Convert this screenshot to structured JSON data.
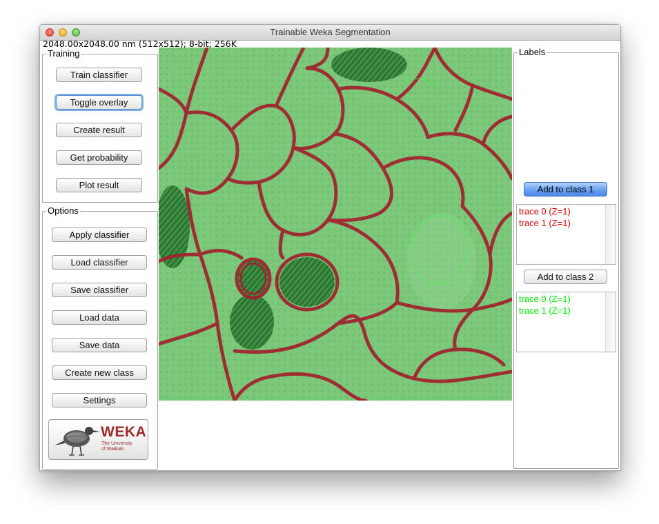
{
  "window": {
    "title": "Trainable Weka Segmentation",
    "image_info": "2048.00x2048.00 nm (512x512); 8-bit; 256K"
  },
  "training": {
    "title": "Training",
    "buttons": [
      "Train classifier",
      "Toggle overlay",
      "Create result",
      "Get probability",
      "Plot result"
    ]
  },
  "options": {
    "title": "Options",
    "buttons": [
      "Apply classifier",
      "Load classifier",
      "Save classifier",
      "Load data",
      "Save data",
      "Create new class",
      "Settings"
    ]
  },
  "weka_logo": {
    "name": "WEKA",
    "subtitle_line1": "The University",
    "subtitle_line2": "of Waikato",
    "icon": "weka-bird-icon"
  },
  "labels": {
    "title": "Labels",
    "class1": {
      "button": "Add to class 1",
      "traces": [
        "trace 0 (Z=1)",
        "trace 1 (Z=1)"
      ],
      "color": "#dd0000"
    },
    "class2": {
      "button": "Add to class 2",
      "traces": [
        "trace 0 (Z=1)",
        "trace 1 (Z=1)"
      ],
      "color": "#00ee00"
    }
  },
  "image": {
    "description_icon": "segmentation-overlay-image",
    "overlay_colors": {
      "class1": "#a01e2c",
      "class2": "#6cc36c"
    }
  }
}
